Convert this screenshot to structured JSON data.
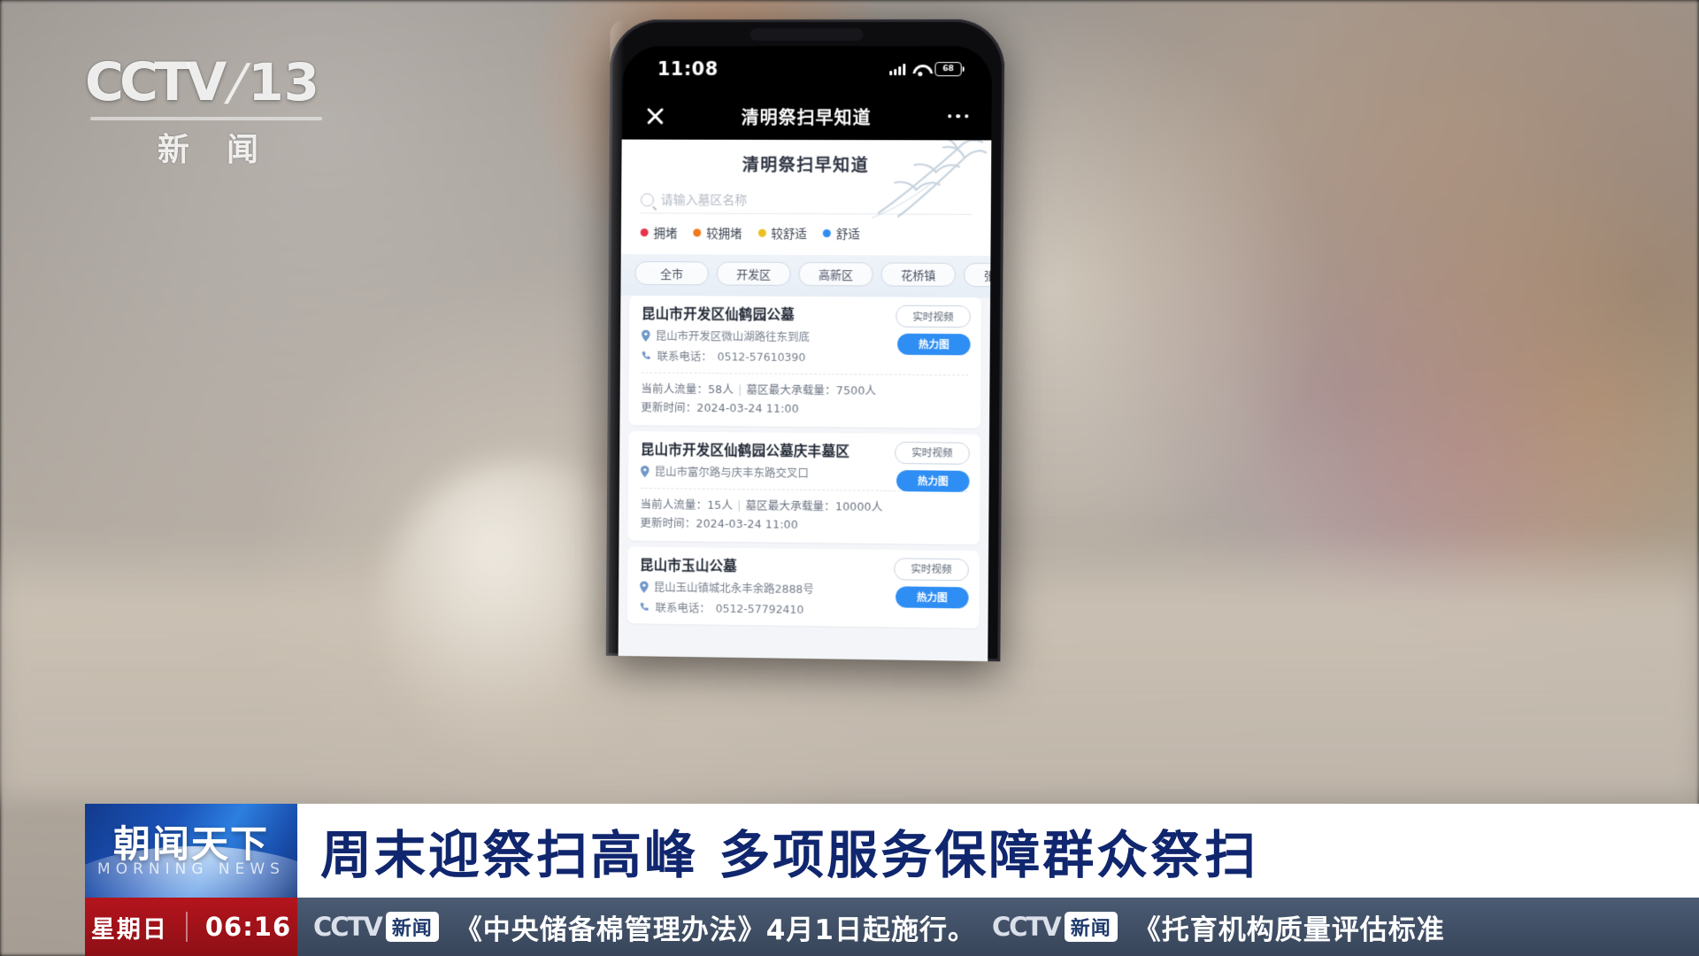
{
  "channel": {
    "logo_text": "CCTV",
    "logo_slash": "/",
    "logo_number": "13",
    "logo_sub": [
      "新",
      "闻"
    ]
  },
  "phone": {
    "status_bar": {
      "time": "11:08",
      "signal_icon": "signal-bars-icon",
      "wifi_icon": "wifi-icon",
      "battery_label": "68"
    },
    "nav": {
      "close_icon": "close-icon",
      "title": "清明祭扫早知道",
      "more_icon": "more-dots-icon"
    },
    "app": {
      "hero_title": "清明祭扫早知道",
      "search": {
        "icon": "search-icon",
        "placeholder": "请输入墓区名称",
        "value": ""
      },
      "legend": [
        {
          "label": "拥堵",
          "color": "#e8344a"
        },
        {
          "label": "较拥堵",
          "color": "#f07a1e"
        },
        {
          "label": "较舒适",
          "color": "#e8c020"
        },
        {
          "label": "舒适",
          "color": "#2f8ef4"
        }
      ],
      "filters": [
        "全市",
        "开发区",
        "高新区",
        "花桥镇",
        "张浦镇"
      ],
      "buttons": {
        "video": "实时视频",
        "heatmap": "热力图"
      },
      "labels": {
        "phone_prefix": "联系电话：",
        "current_flow": "当前人流量：",
        "capacity": "墓区最大承载量：",
        "updated": "更新时间："
      },
      "cemeteries": [
        {
          "name": "昆山市开发区仙鹤园公墓",
          "address": "昆山市开发区微山湖路往东到底",
          "phone": "0512-57610390",
          "current_flow": "58人",
          "capacity": "7500人",
          "updated": "2024-03-24 11:00"
        },
        {
          "name": "昆山市开发区仙鹤园公墓庆丰墓区",
          "address": "昆山市富尔路与庆丰东路交叉口",
          "phone": "",
          "current_flow": "15人",
          "capacity": "10000人",
          "updated": "2024-03-24 11:00"
        },
        {
          "name": "昆山市玉山公墓",
          "address": "昆山玉山镇城北永丰余路2888号",
          "phone": "0512-57792410",
          "current_flow": "",
          "capacity": "",
          "updated": ""
        }
      ]
    }
  },
  "lower_third": {
    "program_cn": "朝闻天下",
    "program_en": "MORNING NEWS",
    "headline": "周末迎祭扫高峰 多项服务保障群众祭扫",
    "weekday": "星期日",
    "clock": "06:16",
    "ticker": [
      {
        "cctv": "CCTV",
        "badge": "新闻",
        "text": "《中央储备棉管理办法》4月1日起施行。"
      },
      {
        "cctv": "CCTV",
        "badge": "新闻",
        "text": "《托育机构质量评估标准"
      }
    ]
  }
}
